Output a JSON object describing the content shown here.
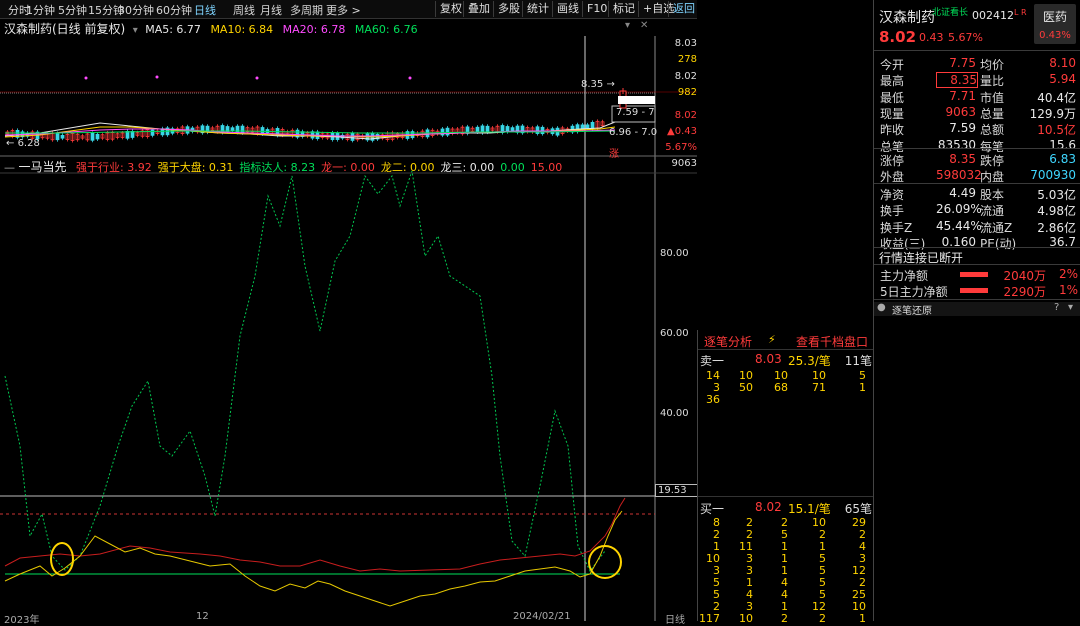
{
  "toolbar": {
    "timeframes": [
      "分时",
      "1分钟",
      "5分钟",
      "15分钟",
      "30分钟",
      "60分钟",
      "日线",
      "周线",
      "月线",
      "多周期",
      "更多 >"
    ],
    "active_timeframe": "日线",
    "buttons": [
      "复权",
      "叠加",
      "多股",
      "统计",
      "画线",
      "F10",
      "标记",
      "+自选",
      "返回"
    ]
  },
  "ma_bar": {
    "title": "汉森制药(日线 前复权)",
    "ma5": "MA5: 6.77",
    "ma10": "MA10: 6.84",
    "ma20": "MA20: 6.78",
    "ma60": "MA60: 6.76"
  },
  "price_axis": {
    "labels": [
      "8.03",
      "278",
      "8.02",
      "982",
      "8.02",
      "7.59 - 7",
      "6.96 - 7.0",
      "0.43",
      "5.67%"
    ],
    "callout": "8.35",
    "low_label": "6.28",
    "tag": "涨"
  },
  "indicator_bar": {
    "name": "一马当先",
    "items": [
      {
        "text": "强于行业: 3.92",
        "color": "#ff3b3b"
      },
      {
        "text": "强于大盘: 0.31",
        "color": "#ffd400"
      },
      {
        "text": "指标达人: 8.23",
        "color": "#00e05a"
      },
      {
        "text": "龙一: 0.00",
        "color": "#ff3b3b"
      },
      {
        "text": "龙二: 0.00",
        "color": "#ffd400"
      },
      {
        "text": "龙三: 0.00",
        "color": "#e8e8e8"
      },
      {
        "text": "0.00",
        "color": "#00e05a"
      },
      {
        "text": "15.00",
        "color": "#ff3b3b"
      }
    ]
  },
  "indicator_axis": {
    "top": "9063",
    "l80": "80.00",
    "l60": "60.00",
    "l40": "40.00",
    "cur": "19.53"
  },
  "bottom_axis": {
    "d1": "2023年",
    "d2": "12",
    "d3": "2024/02/21",
    "d4": "日线"
  },
  "stock": {
    "name": "汉森制药",
    "tag": "北证看长",
    "code": "002412",
    "lr": "L R",
    "sector": "医药",
    "sector_change": "0.43%",
    "price": "8.02",
    "change": "0.43",
    "change_pct": "5.67%"
  },
  "quote_rows": [
    {
      "l1": "今开",
      "v1": "7.75",
      "c1": "red",
      "l2": "均价",
      "v2": "8.10",
      "c2": "red"
    },
    {
      "l1": "最高",
      "v1": "8.35",
      "c1": "red",
      "l2": "量比",
      "v2": "5.94",
      "c2": "red",
      "box": true
    },
    {
      "l1": "最低",
      "v1": "7.71",
      "c1": "red",
      "l2": "市值",
      "v2": "40.4亿",
      "c2": "white"
    },
    {
      "l1": "现量",
      "v1": "9063",
      "c1": "red",
      "l2": "总量",
      "v2": "129.9万",
      "c2": "white"
    },
    {
      "l1": "昨收",
      "v1": "7.59",
      "c1": "white",
      "l2": "总额",
      "v2": "10.5亿",
      "c2": "red"
    },
    {
      "l1": "总笔",
      "v1": "83530",
      "c1": "white",
      "l2": "每笔",
      "v2": "15.6",
      "c2": "white"
    }
  ],
  "limit_rows": [
    {
      "l1": "涨停",
      "v1": "8.35",
      "c1": "red",
      "l2": "跌停",
      "v2": "6.83",
      "c2": "cyan"
    },
    {
      "l1": "外盘",
      "v1": "598032",
      "c1": "red",
      "l2": "内盘",
      "v2": "700930",
      "c2": "cyan"
    }
  ],
  "fund_rows": [
    {
      "l1": "净资",
      "v1": "4.49",
      "l2": "股本",
      "v2": "5.03亿"
    },
    {
      "l1": "换手",
      "v1": "26.09%",
      "l2": "流通",
      "v2": "4.98亿"
    },
    {
      "l1": "换手Z",
      "v1": "45.44%",
      "l2": "流通Z",
      "v2": "2.86亿"
    },
    {
      "l1": "收益(三)",
      "v1": "0.160",
      "l2": "PE(动)",
      "v2": "36.7"
    }
  ],
  "status_text": "行情连接已断开",
  "flows": [
    {
      "label": "主力净额",
      "amount": "2040万",
      "pct": "2%"
    },
    {
      "label": "5日主力净额",
      "amount": "2290万",
      "pct": "1%"
    }
  ],
  "tick_header": {
    "label": "逐笔还原",
    "help": "?"
  },
  "book": {
    "tabs": [
      "逐笔分析",
      "查看千档盘口"
    ],
    "sell": {
      "label": "卖一",
      "price": "8.03",
      "size": "25.3/笔",
      "count": "11笔",
      "rows": [
        [
          "14",
          "10",
          "10",
          "10",
          "5"
        ],
        [
          "3",
          "50",
          "68",
          "71",
          "1"
        ],
        [
          "36",
          "",
          "",
          "",
          ""
        ]
      ]
    },
    "buy": {
      "label": "买一",
      "price": "8.02",
      "size": "15.1/笔",
      "count": "65笔",
      "rows": [
        [
          "8",
          "2",
          "2",
          "10",
          "29"
        ],
        [
          "2",
          "2",
          "5",
          "2",
          "2"
        ],
        [
          "1",
          "11",
          "1",
          "1",
          "4"
        ],
        [
          "10",
          "3",
          "1",
          "5",
          "3"
        ],
        [
          "3",
          "3",
          "1",
          "5",
          "12"
        ],
        [
          "5",
          "1",
          "4",
          "5",
          "2"
        ],
        [
          "5",
          "4",
          "4",
          "5",
          "25"
        ],
        [
          "2",
          "3",
          "1",
          "12",
          "10"
        ],
        [
          "117",
          "10",
          "2",
          "2",
          "1"
        ]
      ]
    }
  }
}
